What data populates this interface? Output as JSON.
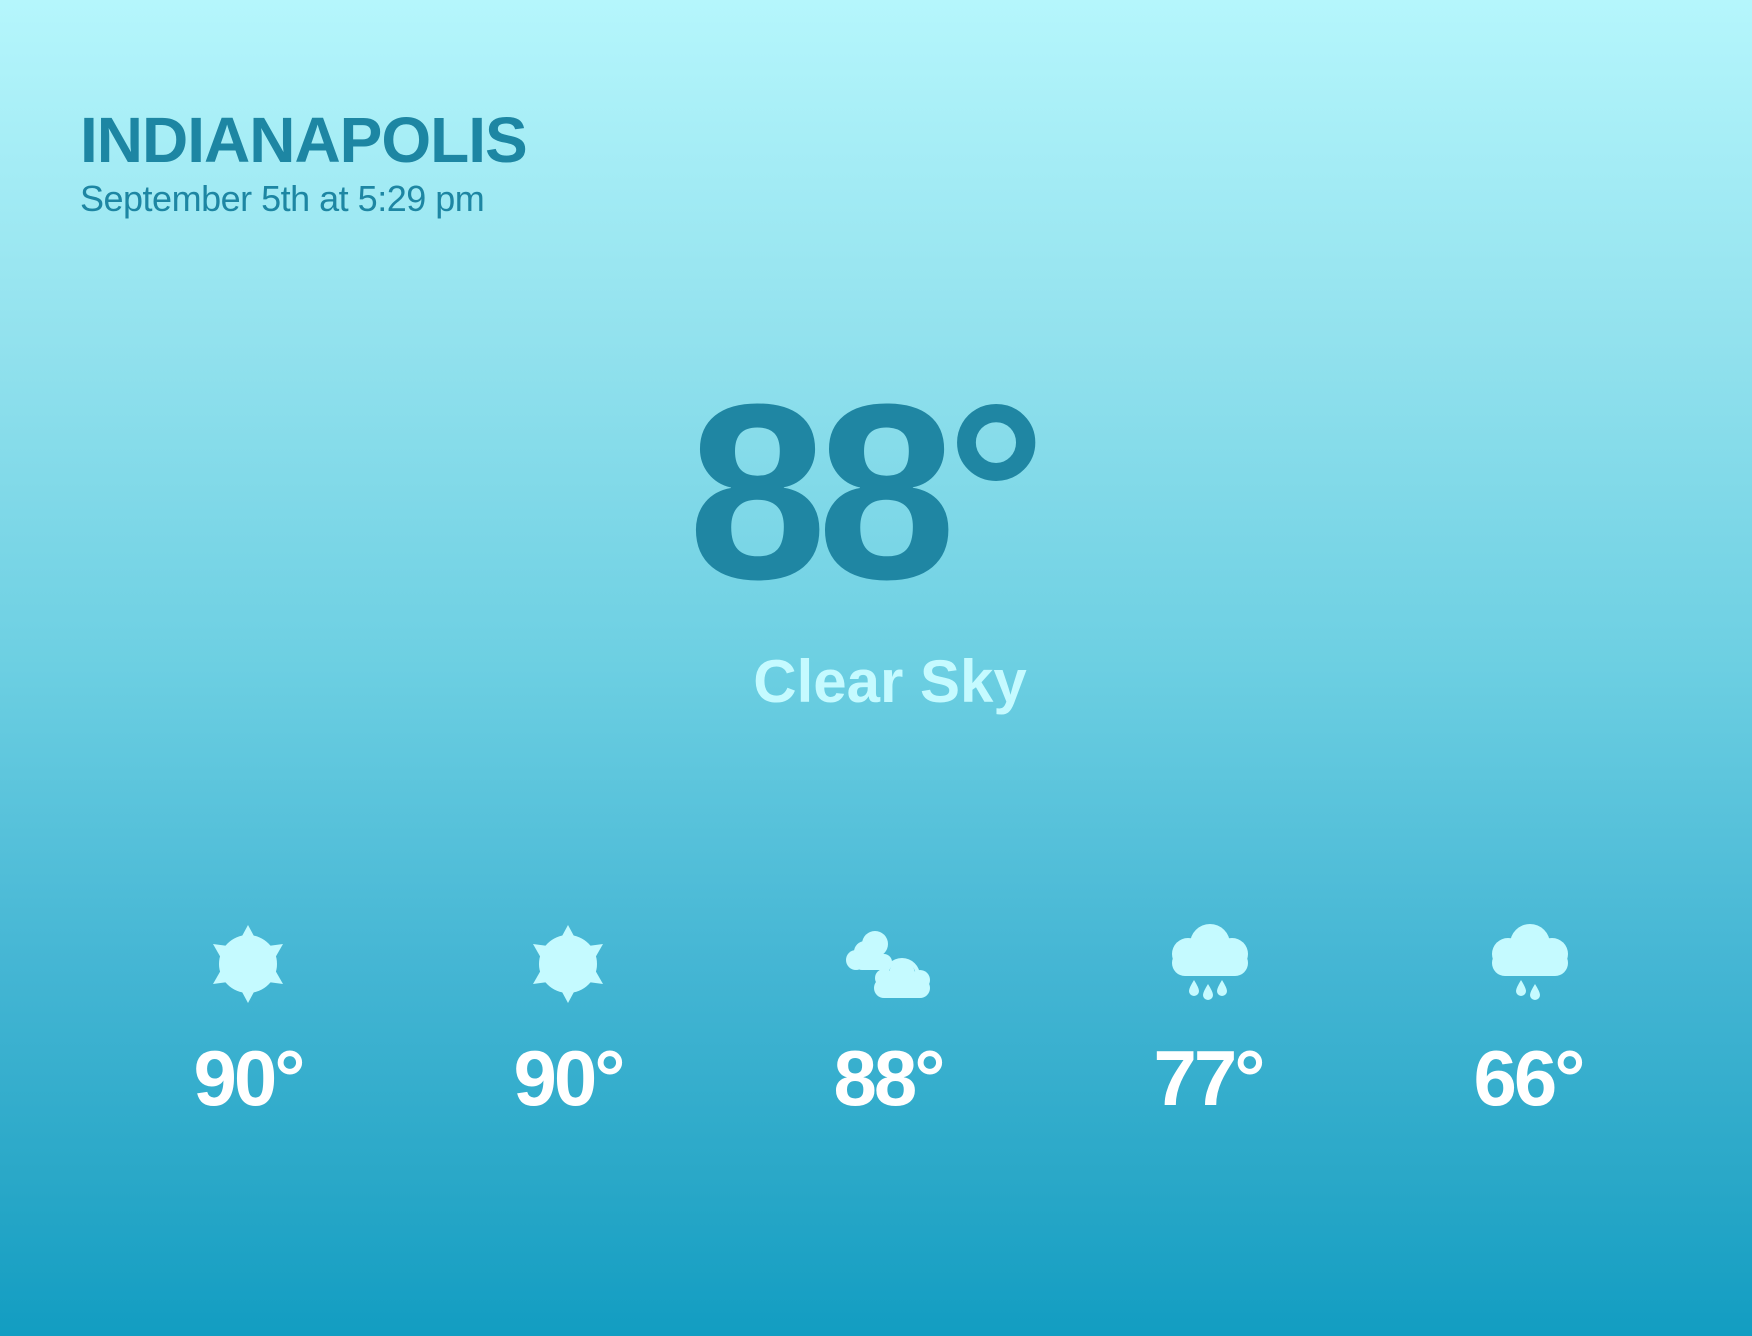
{
  "location": {
    "city": "INDIANAPOLIS",
    "datetime": "September 5th at 5:29 pm"
  },
  "current": {
    "temperature": "88°",
    "condition": "Clear Sky"
  },
  "forecast": [
    {
      "icon": "sun-icon",
      "temperature": "90°"
    },
    {
      "icon": "sun-icon",
      "temperature": "90°"
    },
    {
      "icon": "partly-cloudy-icon",
      "temperature": "88°"
    },
    {
      "icon": "rain-cloud-icon",
      "temperature": "77°"
    },
    {
      "icon": "rain-cloud-icon",
      "temperature": "66°"
    }
  ],
  "colors": {
    "primary_text": "#1d86a3",
    "condition_text": "#c5faff",
    "forecast_text": "#ffffff",
    "icon_fill": "#c5faff"
  }
}
